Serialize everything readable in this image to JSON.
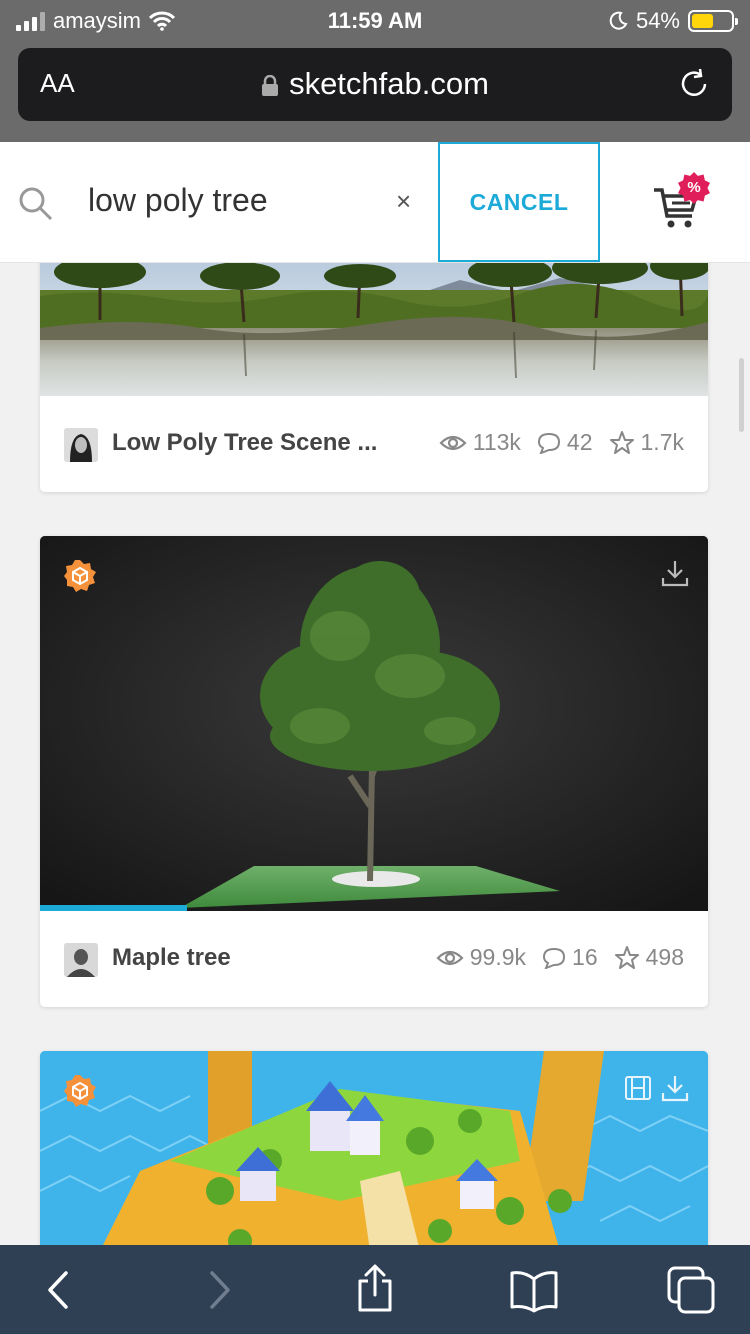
{
  "status_bar": {
    "carrier": "amaysim",
    "time": "11:59 AM",
    "battery": "54%",
    "battery_level": 0.54
  },
  "browser": {
    "text_size_label": "AA",
    "url": "sketchfab.com"
  },
  "search": {
    "query": "low poly tree",
    "clear_label": "×",
    "cancel_label": "CANCEL",
    "cart_badge": "%"
  },
  "results": [
    {
      "title": "Low Poly Tree Scene ...",
      "views": "113k",
      "comments": "42",
      "likes": "1.7k"
    },
    {
      "title": "Maple tree",
      "views": "99.9k",
      "comments": "16",
      "likes": "498",
      "loading_progress": 0.22
    },
    {
      "title": ""
    }
  ],
  "colors": {
    "accent": "#1caad9",
    "badge": "#e01e5a",
    "model_badge": "#f5913a",
    "toolbar": "#2f3f54"
  },
  "icons": [
    "signal-icon",
    "wifi-icon",
    "moon-icon",
    "battery-icon",
    "lock-icon",
    "reload-icon",
    "search-icon",
    "cart-icon",
    "eye-icon",
    "comment-icon",
    "star-icon",
    "download-icon",
    "film-icon",
    "back-icon",
    "forward-icon",
    "share-icon",
    "bookmarks-icon",
    "tabs-icon"
  ]
}
